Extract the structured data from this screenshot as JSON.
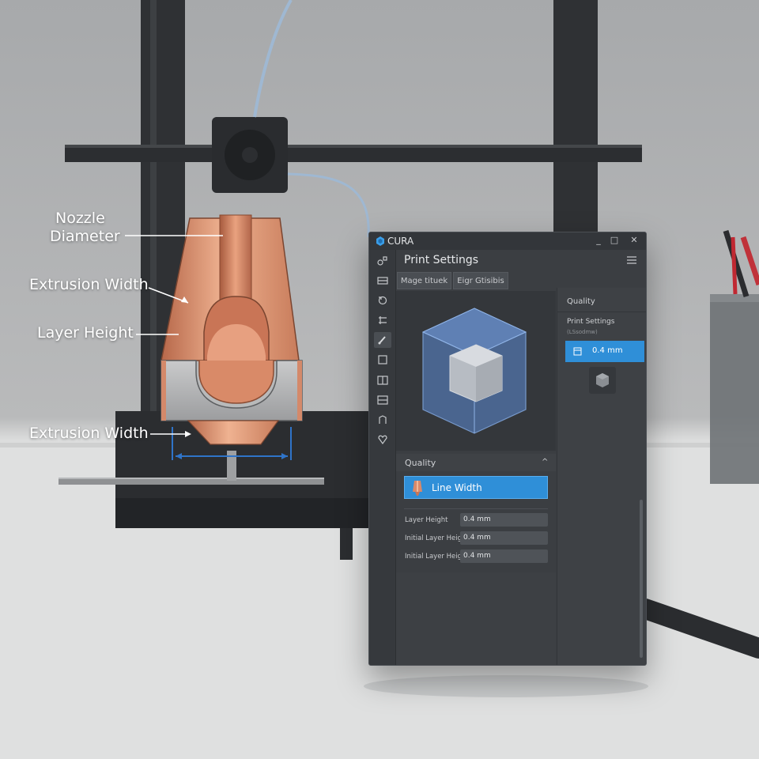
{
  "diagram": {
    "labels": {
      "nozzle_diameter_line1": "Nozzle",
      "nozzle_diameter_line2": "Diameter",
      "extrusion_width_top": "Extrusion Width",
      "layer_height": "Layer Height",
      "extrusion_width_bottom": "Extrusion Width"
    }
  },
  "window": {
    "app_title": "CURA",
    "minimize": "_",
    "maximize": "□",
    "close": "✕"
  },
  "print_settings": {
    "title": "Print Settings",
    "tabs": [
      "Mage tituek",
      "Eigr Gtisibis"
    ],
    "tool_icons": [
      "scale-icon",
      "layers-icon",
      "rotate-icon",
      "move-icon",
      "brush-icon",
      "square-icon",
      "book-icon",
      "support-icon",
      "mirror-icon",
      "gear-heart-icon"
    ],
    "quality_section": {
      "header": "Quality",
      "selected_item": "Line Width",
      "rows": [
        {
          "label": "Layer Height",
          "value": "0.4 mm"
        },
        {
          "label": "Initial Layer Height",
          "value": "0.4 mm"
        },
        {
          "label": "Initial Layer Height",
          "value": "0.4 mm"
        }
      ]
    },
    "right_panel": {
      "header": "Quality",
      "settings_label": "Print Settings",
      "settings_sub": "(LSsodmw)",
      "selected_value": "0.4 mm"
    }
  },
  "colors": {
    "accent": "#2f8fd8",
    "panel": "#3b3e42",
    "copper": "#c8795a"
  }
}
